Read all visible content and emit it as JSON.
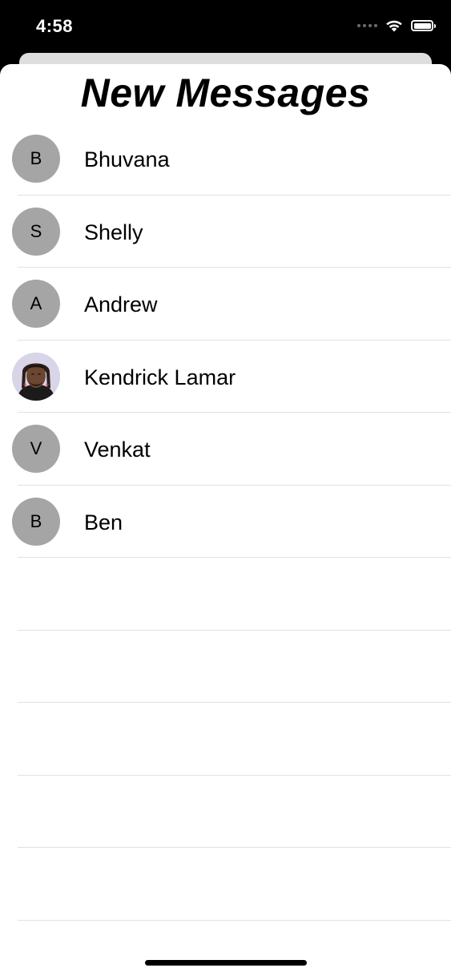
{
  "status_bar": {
    "time": "4:58",
    "icons": [
      "cellular-signal-icon",
      "wifi-icon",
      "battery-icon"
    ]
  },
  "sheet": {
    "title": "New Messages"
  },
  "contacts": [
    {
      "name": "Bhuvana",
      "initial": "B",
      "has_photo": false
    },
    {
      "name": "Shelly",
      "initial": "S",
      "has_photo": false
    },
    {
      "name": "Andrew",
      "initial": "A",
      "has_photo": false
    },
    {
      "name": "Kendrick Lamar",
      "initial": "",
      "has_photo": true
    },
    {
      "name": "Venkat",
      "initial": "V",
      "has_photo": false
    },
    {
      "name": "Ben",
      "initial": "B",
      "has_photo": false
    }
  ],
  "empty_rows": 5,
  "colors": {
    "avatar_placeholder": "#a5a5a5",
    "divider": "#e1e1e1",
    "background_dim": "#000000",
    "sheet_background": "#ffffff"
  }
}
